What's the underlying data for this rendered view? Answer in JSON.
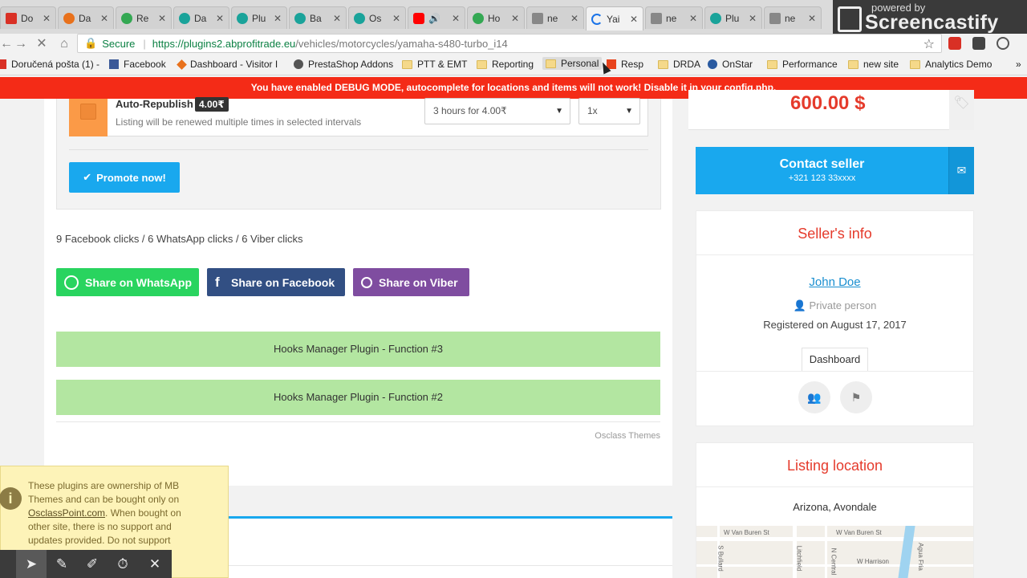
{
  "browser": {
    "tabs": [
      {
        "label": "Do",
        "color": "#d93025"
      },
      {
        "label": "Da",
        "color": "#e8711c"
      },
      {
        "label": "Re",
        "color": "#34a853"
      },
      {
        "label": "Da",
        "color": "#1aa39a"
      },
      {
        "label": "Plu",
        "color": "#1aa39a"
      },
      {
        "label": "Ba",
        "color": "#1aa39a"
      },
      {
        "label": "Os",
        "color": "#1aa39a"
      },
      {
        "label": "",
        "color": "#ff0000"
      },
      {
        "label": "Ho",
        "color": "#34a853"
      },
      {
        "label": "ne",
        "color": "#888888"
      },
      {
        "label": "Yai",
        "color": "#1a73e8"
      },
      {
        "label": "ne",
        "color": "#888888"
      },
      {
        "label": "Plu",
        "color": "#1aa39a"
      },
      {
        "label": "ne",
        "color": "#888888"
      }
    ],
    "screencastify_top": "powered by",
    "screencastify_name": "Screencastify Lite",
    "secure_label": "Secure",
    "url_host": "https://plugins2.abprofitrade.eu",
    "url_path": "/vehicles/motorcycles/yamaha-s480-turbo_i14",
    "bookmarks": [
      {
        "label": "Doručená pošta (1) -",
        "icon": "gmail-icon"
      },
      {
        "label": "Facebook",
        "icon": "facebook-icon"
      },
      {
        "label": "Dashboard - Visitor I",
        "icon": "analytics-icon"
      },
      {
        "label": "PrestaShop Addons",
        "icon": "prestashop-icon"
      },
      {
        "label": "PTT & EMT",
        "icon": "folder-icon"
      },
      {
        "label": "Reporting",
        "icon": "folder-icon"
      },
      {
        "label": "Personal",
        "icon": "folder-icon"
      },
      {
        "label": "Resp",
        "icon": "resp-icon"
      },
      {
        "label": "DRDA",
        "icon": "folder-icon"
      },
      {
        "label": "OnStar",
        "icon": "onstar-icon"
      },
      {
        "label": "Performance",
        "icon": "folder-icon"
      },
      {
        "label": "new site",
        "icon": "folder-icon"
      },
      {
        "label": "Analytics Demo",
        "icon": "folder-icon"
      }
    ]
  },
  "debug_message": "You have enabled DEBUG MODE, autocomplete for locations and items will not work! Disable it in your config.php.",
  "promotion": {
    "title": "Auto-Republish",
    "price": "4.00₹",
    "description": "Listing will be renewed multiple times in selected intervals",
    "interval_select": "3 hours for 4.00₹",
    "repeat_select": "1x",
    "promote_button": "Promote now!"
  },
  "share": {
    "clicks_text": "9 Facebook clicks / 6 WhatsApp clicks / 6 Viber clicks",
    "whatsapp_label": "Share on WhatsApp",
    "facebook_label": "Share on Facebook",
    "viber_label": "Share on Viber",
    "colors": {
      "whatsapp": "#29d45f",
      "facebook": "#324f83",
      "viber": "#7f4da0"
    }
  },
  "hooks": [
    "Hooks Manager Plugin - Function #3",
    "Hooks Manager Plugin - Function #2"
  ],
  "theme_credit": "Osclass Themes",
  "sidebar": {
    "price": "600.00 $",
    "contact_label": "Contact seller",
    "contact_phone": "+321 123 33xxxx",
    "seller_info_title": "Seller's info",
    "seller_name": "John Doe",
    "seller_type": "Private person",
    "registered": "Registered on August 17, 2017",
    "dashboard_tab": "Dashboard",
    "location_title": "Listing location",
    "location_city": "Arizona, Avondale",
    "map_labels": [
      "W Van Buren St",
      "W Van Buren St",
      "Agua Fria",
      "S Bullard",
      "Litchfield",
      "N Central",
      "W Harrison"
    ]
  },
  "notice": {
    "text_before": "These plugins are ownership of MB Themes and can be bought only on ",
    "link": "OsclassPoint.com",
    "text_after": ". When bought on other site, there is no support and updates provided. Do not support"
  },
  "accent": "#19a8ee",
  "price_color": "#e53b2c"
}
